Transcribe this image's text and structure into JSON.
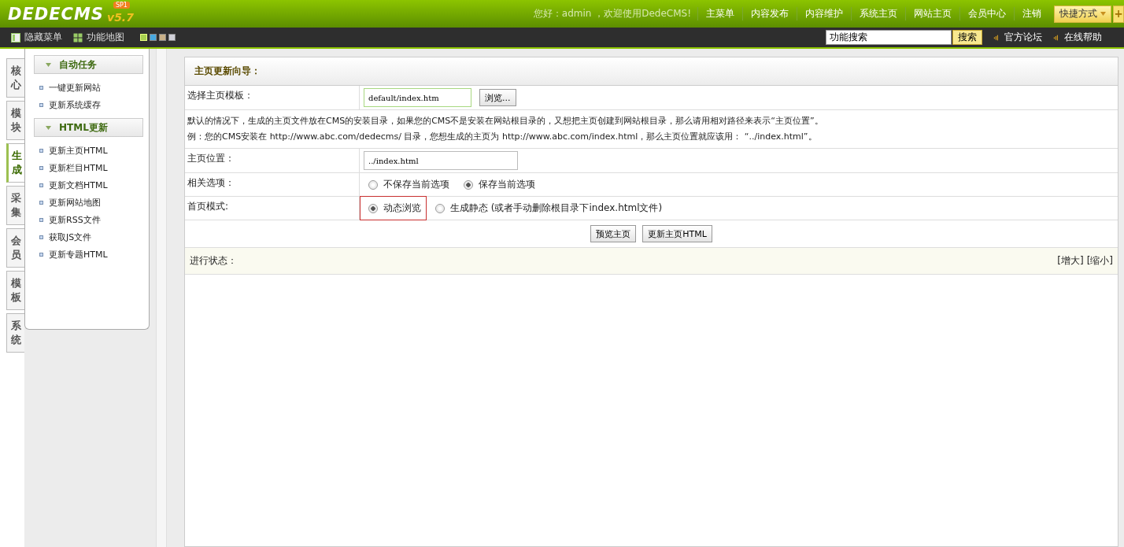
{
  "header": {
    "logo": "DEDECMS",
    "version": "v5.7",
    "badge": "SP1",
    "greeting": "您好：admin ，欢迎使用DedeCMS!",
    "nav": [
      "主菜单",
      "内容发布",
      "内容维护",
      "系统主页",
      "网站主页",
      "会员中心",
      "注销"
    ],
    "shortcut": "快捷方式",
    "add": "+"
  },
  "toolbar": {
    "items": [
      "隐藏菜单",
      "功能地图"
    ],
    "themes": [
      {
        "color": "#a8d050",
        "selected": true
      },
      {
        "color": "#48a8e0",
        "selected": false
      },
      {
        "color": "#c8b088",
        "selected": false
      },
      {
        "color": "#d0d0d8",
        "selected": false
      }
    ],
    "search_value": "功能搜索",
    "search_button": "搜索",
    "links": [
      "官方论坛",
      "在线帮助"
    ]
  },
  "side_tabs": [
    {
      "label": "核心",
      "selected": false
    },
    {
      "label": "模块",
      "selected": false
    },
    {
      "label": "生成",
      "selected": true
    },
    {
      "label": "采集",
      "selected": false
    },
    {
      "label": "会员",
      "selected": false
    },
    {
      "label": "模板",
      "selected": false
    },
    {
      "label": "系统",
      "selected": false
    }
  ],
  "sidebar": [
    {
      "title": "自动任务",
      "items": [
        "一键更新网站",
        "更新系统缓存"
      ]
    },
    {
      "title": "HTML更新",
      "items": [
        "更新主页HTML",
        "更新栏目HTML",
        "更新文档HTML",
        "更新网站地图",
        "更新RSS文件",
        "获取JS文件",
        "更新专题HTML"
      ]
    }
  ],
  "main": {
    "title": "主页更新向导：",
    "rows": [
      {
        "kind": "template",
        "label": "选择主页模板：",
        "value": "default/index.htm",
        "button": "浏览..."
      },
      {
        "kind": "note",
        "lines": [
          "默认的情况下，生成的主页文件放在CMS的安装目录，如果您的CMS不是安装在网站根目录的，又想把主页创建到网站根目录，那么请用相对路径来表示“主页位置”。",
          "例：您的CMS安装在 http://www.abc.com/dedecms/ 目录，您想生成的主页为 http://www.abc.com/index.html，那么主页位置就应该用： “../index.html”。"
        ]
      },
      {
        "kind": "input",
        "label": "主页位置：",
        "value": "../index.html"
      },
      {
        "kind": "radio",
        "label": "相关选项：",
        "options": [
          {
            "label": "不保存当前选项",
            "selected": false,
            "highlighted": false
          },
          {
            "label": "保存当前选项",
            "selected": true,
            "highlighted": false
          }
        ]
      },
      {
        "kind": "radio",
        "label": "首页模式:",
        "options": [
          {
            "label": "动态浏览",
            "selected": true,
            "highlighted": true
          },
          {
            "label": "生成静态 (或者手动删除根目录下index.html文件)",
            "selected": false,
            "highlighted": false
          }
        ]
      }
    ],
    "actions": [
      "预览主页",
      "更新主页HTML"
    ],
    "status": {
      "label": "进行状态：",
      "links": [
        "[增大]",
        "[缩小]"
      ]
    }
  }
}
